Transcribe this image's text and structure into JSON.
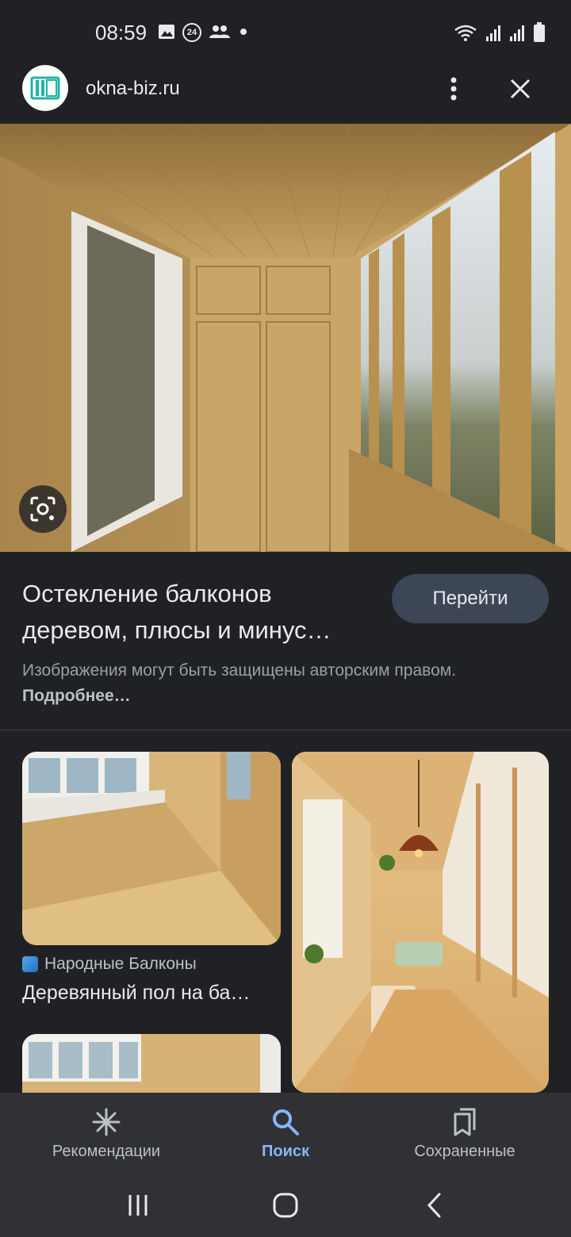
{
  "status_bar": {
    "time": "08:59",
    "icons": [
      "image-icon",
      "24-badge-icon",
      "people-icon",
      "dot-icon",
      "wifi-icon",
      "signal-icon",
      "signal-icon",
      "battery-icon"
    ],
    "badge_text": "24"
  },
  "header": {
    "site_name": "okna-biz.ru",
    "menu_icon": "more-vert-icon",
    "close_icon": "close-icon"
  },
  "result": {
    "title": "Остекление балконов деревом, плюсы и минус…",
    "visit_button": "Перейти",
    "copyright_text": "Изображения могут быть защищены авторским правом.",
    "more_link": "Подробнее…"
  },
  "related": [
    {
      "source": "Народные Балконы",
      "title": "Деревянный пол на ба…"
    }
  ],
  "bottom_nav": {
    "items": [
      {
        "label": "Рекомендации",
        "icon": "asterisk-icon",
        "active": false
      },
      {
        "label": "Поиск",
        "icon": "search-icon",
        "active": true
      },
      {
        "label": "Сохраненные",
        "icon": "bookmarks-icon",
        "active": false
      }
    ]
  },
  "colors": {
    "background": "#202124",
    "accent": "#8ab4f8",
    "button_bg": "#3c4656",
    "nav_bg": "#303134"
  }
}
